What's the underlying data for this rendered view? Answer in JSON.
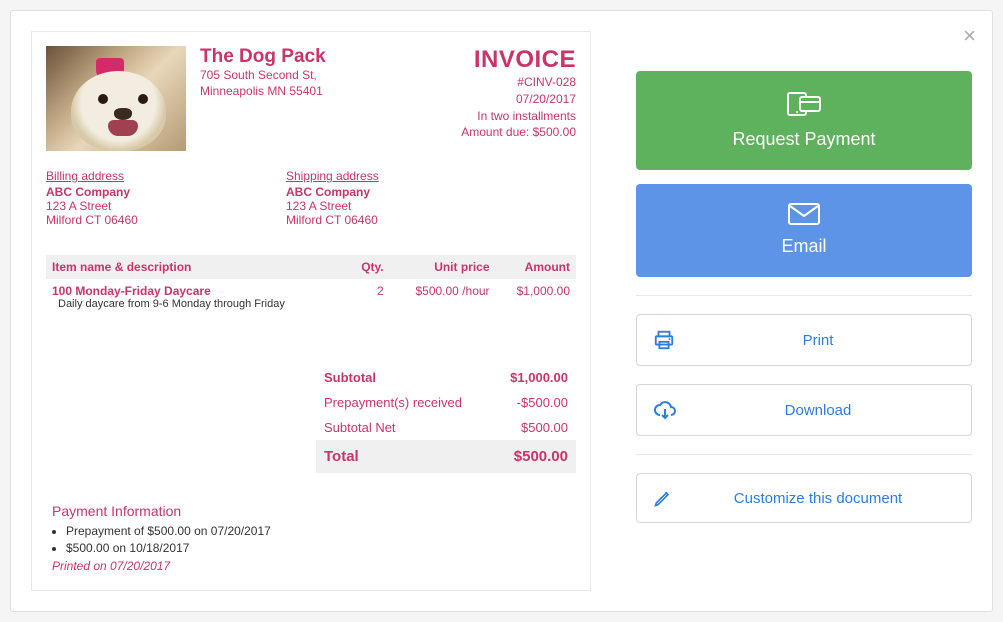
{
  "company": {
    "name": "The Dog Pack",
    "addr1": "705 South Second St,",
    "addr2": "Minneapolis MN 55401"
  },
  "invoice": {
    "title": "INVOICE",
    "number": "#CINV-028",
    "date": "07/20/2017",
    "terms": "In two installments",
    "amount_due_label": "Amount due:",
    "amount_due": "$500.00"
  },
  "billing": {
    "label": "Billing address",
    "name": "ABC Company",
    "line1": "123 A Street",
    "line2": "Milford CT 06460"
  },
  "shipping": {
    "label": "Shipping address",
    "name": "ABC Company",
    "line1": "123 A Street",
    "line2": "Milford CT 06460"
  },
  "columns": {
    "item": "Item name & description",
    "qty": "Qty.",
    "unit": "Unit price",
    "amount": "Amount"
  },
  "line_item": {
    "name": "100 Monday-Friday Daycare",
    "desc": "Daily daycare from 9-6 Monday through Friday",
    "qty": "2",
    "unit": "$500.00 /hour",
    "amount": "$1,000.00"
  },
  "totals": {
    "subtotal_label": "Subtotal",
    "subtotal": "$1,000.00",
    "prepay_label": "Prepayment(s) received",
    "prepay": "-$500.00",
    "net_label": "Subtotal Net",
    "net": "$500.00",
    "total_label": "Total",
    "total": "$500.00"
  },
  "payment_info": {
    "title": "Payment Information",
    "line1": "Prepayment of $500.00 on 07/20/2017",
    "line2": "$500.00 on 10/18/2017",
    "printed": "Printed on 07/20/2017"
  },
  "actions": {
    "request": "Request Payment",
    "email": "Email",
    "print": "Print",
    "download": "Download",
    "customize": "Customize this document"
  }
}
